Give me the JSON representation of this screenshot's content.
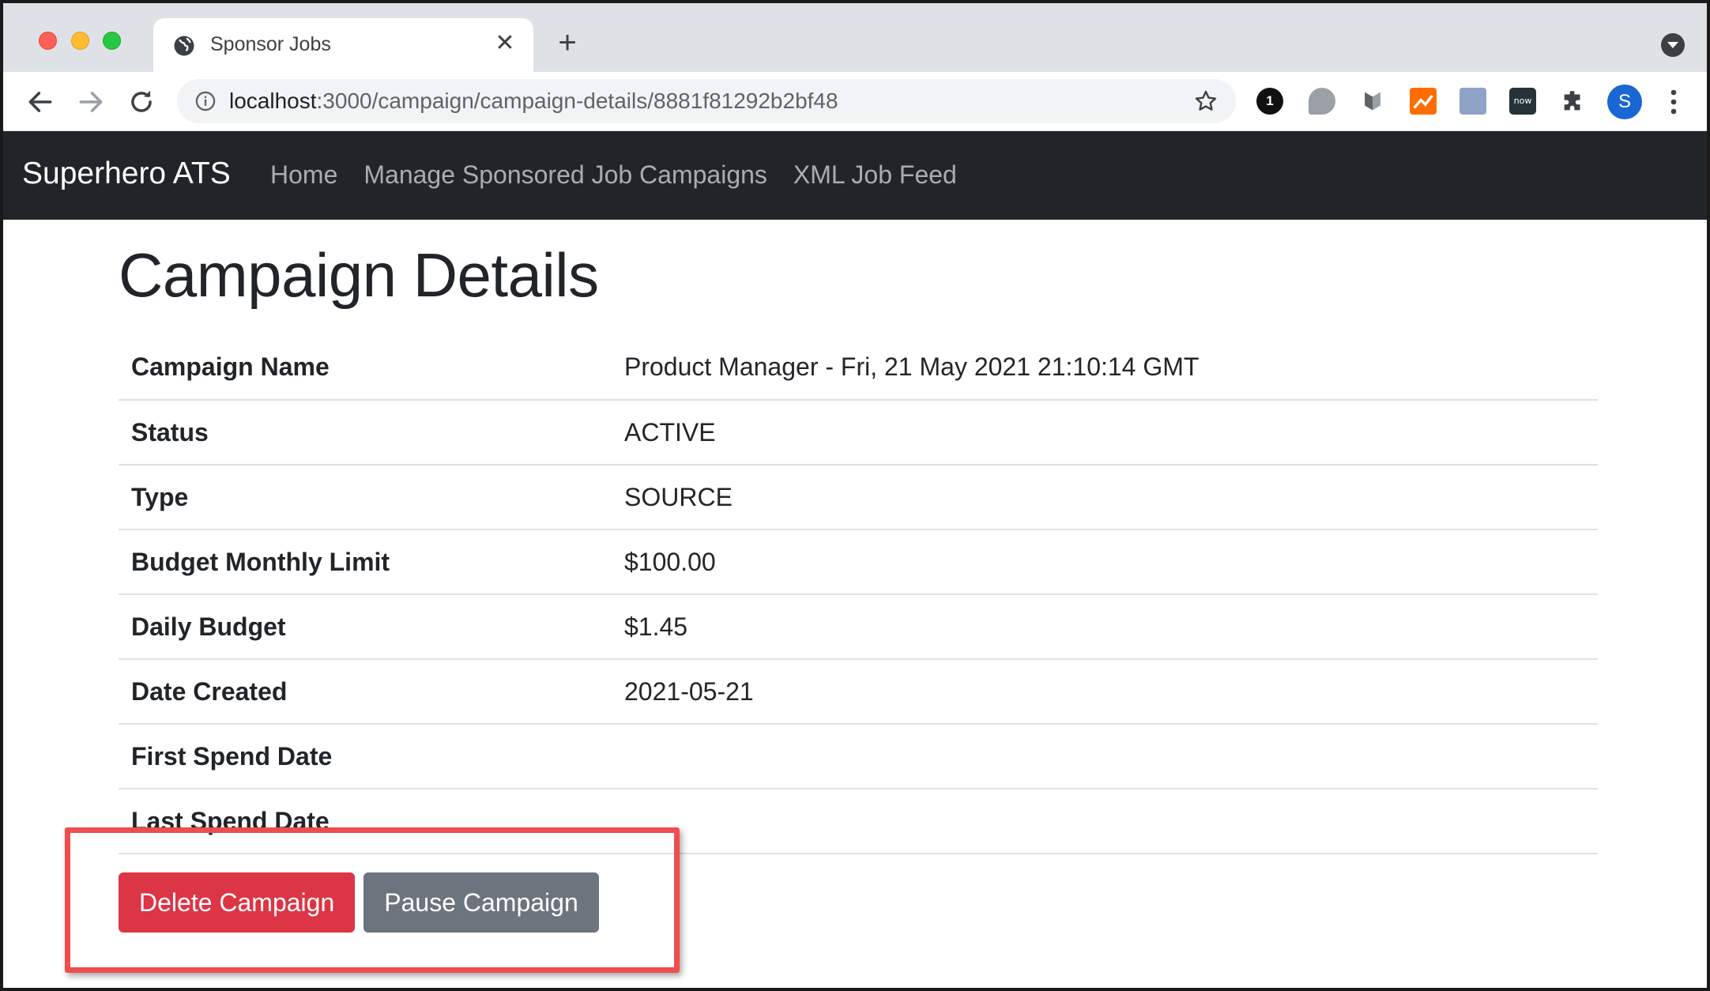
{
  "browser": {
    "tab": {
      "title": "Sponsor Jobs"
    },
    "url": {
      "host": "localhost",
      "path": ":3000/campaign/campaign-details/8881f81292b2bf48"
    },
    "extensions": {
      "ext1_label": "1",
      "ext6_label": "now"
    },
    "profile_initial": "S"
  },
  "navbar": {
    "brand": "Superhero ATS",
    "links": [
      "Home",
      "Manage Sponsored Job Campaigns",
      "XML Job Feed"
    ]
  },
  "page": {
    "title": "Campaign Details",
    "details": [
      {
        "label": "Campaign Name",
        "value": "Product Manager - Fri, 21 May 2021 21:10:14 GMT"
      },
      {
        "label": "Status",
        "value": "ACTIVE"
      },
      {
        "label": "Type",
        "value": "SOURCE"
      },
      {
        "label": "Budget Monthly Limit",
        "value": "$100.00"
      },
      {
        "label": "Daily Budget",
        "value": "$1.45"
      },
      {
        "label": "Date Created",
        "value": "2021-05-21"
      },
      {
        "label": "First Spend Date",
        "value": ""
      },
      {
        "label": "Last Spend Date",
        "value": ""
      }
    ],
    "buttons": {
      "delete": "Delete Campaign",
      "pause": "Pause Campaign"
    }
  },
  "colors": {
    "navbar_bg": "#212529",
    "danger": "#dc3545",
    "secondary": "#6c757d",
    "highlight": "#ef4d4d"
  }
}
